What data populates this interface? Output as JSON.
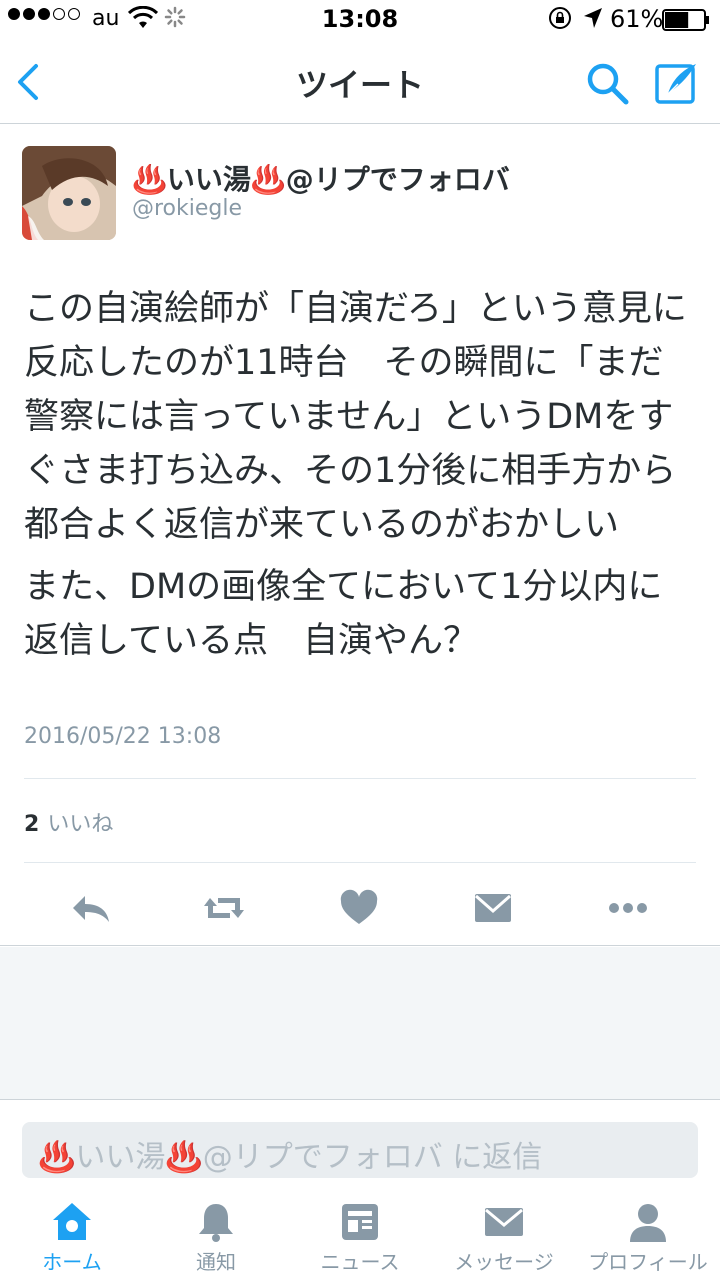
{
  "status_bar": {
    "carrier": "au",
    "time": "13:08",
    "battery_percent": "61%",
    "battery_level": 0.61
  },
  "nav": {
    "title": "ツイート",
    "accent_color": "#1da1f2"
  },
  "tweet": {
    "display_name": "♨️いい湯♨️@リプでフォロバ",
    "handle": "@rokiegle",
    "paragraphs": [
      "この自演絵師が「自演だろ」という意見に反応したのが11時台　その瞬間に「まだ警察には言っていません」というDMをすぐさま打ち込み、その1分後に相手方から都合よく返信が来ているのがおかしい",
      "また、DMの画像全てにおいて1分以内に返信している点　自演やん？"
    ],
    "timestamp": "2016/05/22 13:08",
    "likes_count": "2",
    "likes_label": "いいね"
  },
  "actions": {
    "icons": [
      "reply-icon",
      "retweet-icon",
      "like-icon",
      "dm-icon",
      "more-icon"
    ]
  },
  "reply": {
    "placeholder": "♨️いい湯♨️@リプでフォロバ に返信"
  },
  "tabs": [
    {
      "label": "ホーム",
      "icon": "home-icon",
      "active": true
    },
    {
      "label": "通知",
      "icon": "bell-icon",
      "active": false
    },
    {
      "label": "ニュース",
      "icon": "news-icon",
      "active": false
    },
    {
      "label": "メッセージ",
      "icon": "message-icon",
      "active": false
    },
    {
      "label": "プロフィール",
      "icon": "profile-icon",
      "active": false
    }
  ]
}
